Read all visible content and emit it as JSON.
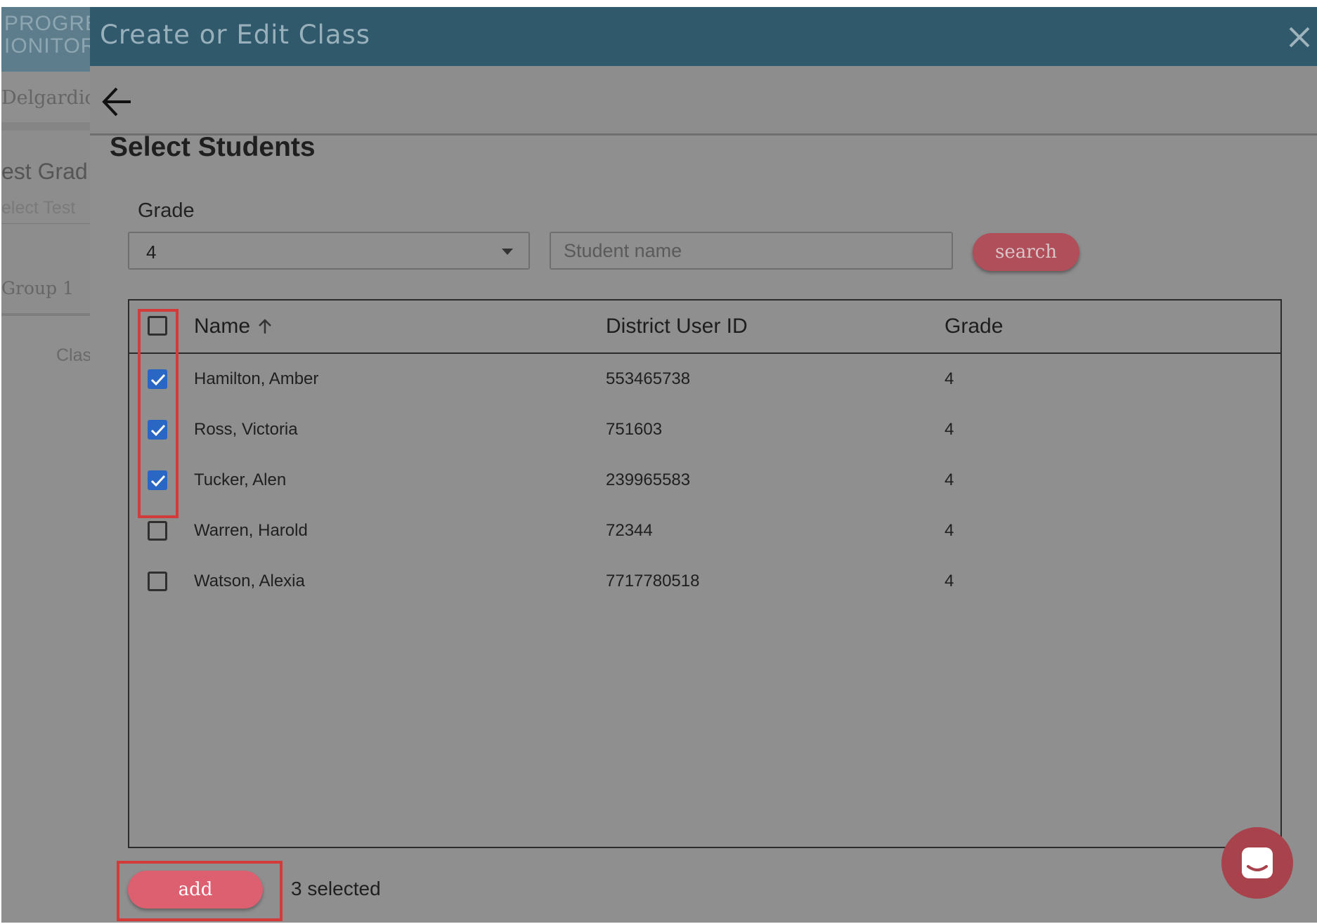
{
  "background": {
    "logo_lines": [
      "PROGRE",
      "IONITOR"
    ],
    "user_name": "Delgardio H",
    "test_grade": "est Grad",
    "select_test": "elect Test",
    "group": "Group 1",
    "class_label": "Clas"
  },
  "modal": {
    "title": "Create or Edit Class",
    "close_icon": "close-icon",
    "back_icon": "arrow-left-icon",
    "section_title": "Select Students",
    "filters": {
      "grade_label": "Grade",
      "grade_value": "4",
      "name_placeholder": "Student name",
      "search_label": "search"
    },
    "table": {
      "columns": [
        "Name",
        "District User ID",
        "Grade"
      ],
      "sort_icon": "arrow-up-icon",
      "select_all_checked": false,
      "rows": [
        {
          "name": "Hamilton, Amber",
          "id": "553465738",
          "grade": "4",
          "checked": true
        },
        {
          "name": "Ross, Victoria",
          "id": "751603",
          "grade": "4",
          "checked": true
        },
        {
          "name": "Tucker, Alen",
          "id": "239965583",
          "grade": "4",
          "checked": true
        },
        {
          "name": "Warren, Harold",
          "id": "72344",
          "grade": "4",
          "checked": false
        },
        {
          "name": "Watson, Alexia",
          "id": "7717780518",
          "grade": "4",
          "checked": false
        }
      ]
    },
    "footer": {
      "add_label": "add",
      "selected_text": "3 selected"
    }
  },
  "colors": {
    "header": "#30596b",
    "checkbox_checked": "#2a66c4",
    "add_button": "#dd6070",
    "search_button": "#b04e5a",
    "highlight": "#d33a3a"
  }
}
